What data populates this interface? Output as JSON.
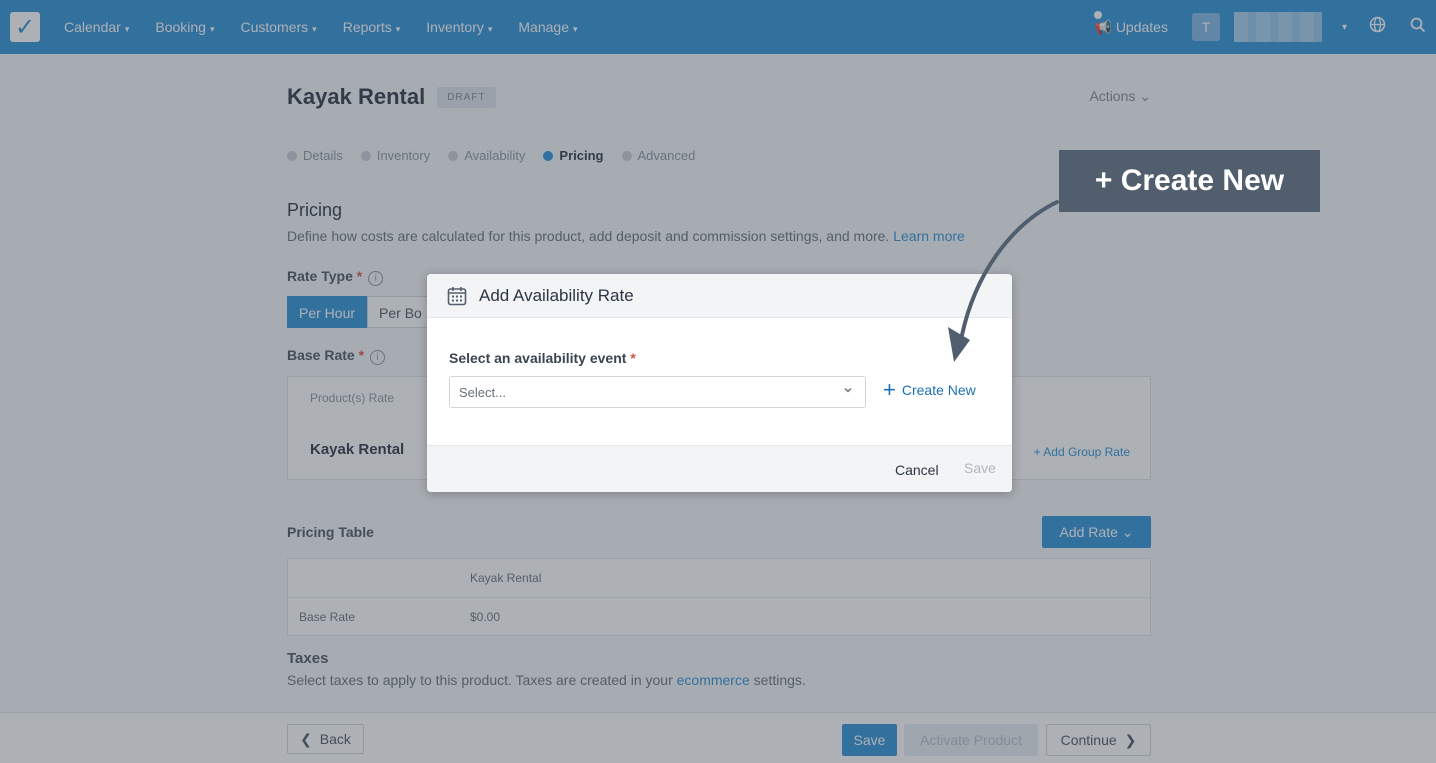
{
  "nav": {
    "items": [
      "Calendar",
      "Booking",
      "Customers",
      "Reports",
      "Inventory",
      "Manage"
    ],
    "caret": "▾",
    "updates": "Updates",
    "avatar_letter": "T",
    "account_caret": "▾"
  },
  "page": {
    "title": "Kayak Rental",
    "badge": "DRAFT",
    "actions": "Actions ⌄",
    "steps": [
      {
        "label": "Details"
      },
      {
        "label": "Inventory"
      },
      {
        "label": "Availability"
      },
      {
        "label": "Pricing"
      },
      {
        "label": "Advanced"
      }
    ],
    "pricing_title": "Pricing",
    "pricing_desc": "Define how costs are calculated for this product, add deposit and commission settings, and more.",
    "learn_more": "Learn more",
    "rate_type_label": "Rate Type",
    "required_mark": "*",
    "info_mark": "i",
    "rate_type_options": [
      "Per Hour",
      "Per Bo"
    ],
    "base_rate_label": "Base Rate",
    "products_rate": "Product(s) Rate",
    "rate_name": "Kayak Rental",
    "add_group_rate": "+ Add Group Rate",
    "pricing_table_title": "Pricing Table",
    "add_rate": "Add Rate ⌄",
    "table": {
      "column": "Kayak Rental",
      "row_label": "Base Rate",
      "row_value": "$0.00"
    },
    "taxes_title": "Taxes",
    "taxes_desc_before": "Select taxes to apply to this product. Taxes are created in your",
    "taxes_link": "ecommerce",
    "taxes_desc_after": "settings."
  },
  "footer": {
    "back": "Back",
    "save": "Save",
    "activate": "Activate Product",
    "continue": "Continue"
  },
  "modal": {
    "title": "Add Availability Rate",
    "field_label": "Select an availability event",
    "required_mark": "*",
    "select_placeholder": "Select...",
    "create_new": "Create New",
    "cancel": "Cancel",
    "save": "Save"
  },
  "callout": {
    "text": "+ Create New"
  },
  "colors": {
    "brand": "#2b8fd6",
    "callout_bg": "#515e6d",
    "link": "#1f6fb5"
  }
}
